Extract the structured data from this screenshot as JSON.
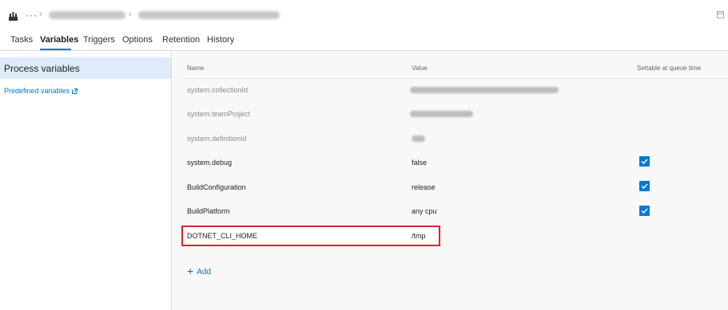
{
  "tabs": [
    {
      "label": "Tasks"
    },
    {
      "label": "Variables"
    },
    {
      "label": "Triggers"
    },
    {
      "label": "Options"
    },
    {
      "label": "Retention"
    },
    {
      "label": "History"
    }
  ],
  "active_tab": "Variables",
  "sidebar": {
    "process_variables_label": "Process variables",
    "predefined_link_label": "Predefined variables"
  },
  "columns": {
    "name": "Name",
    "value": "Value",
    "settable": "Settable at queue time"
  },
  "variables": [
    {
      "name": "system.collectionId",
      "value": "",
      "system": true
    },
    {
      "name": "system.teamProject",
      "value": "",
      "system": true
    },
    {
      "name": "system.definitionId",
      "value": "",
      "system": true
    },
    {
      "name": "system.debug",
      "value": "false",
      "settable": true
    },
    {
      "name": "BuildConfiguration",
      "value": "release",
      "settable": true
    },
    {
      "name": "BuildPlatform",
      "value": "any cpu",
      "settable": true
    },
    {
      "name": "DOTNET_CLI_HOME",
      "value": "/tmp",
      "settable": false,
      "highlighted": true
    }
  ],
  "add_label": "Add",
  "colors": {
    "accent": "#0078d4",
    "highlight_border": "#d9262a",
    "sidebar_selected": "#deecf9"
  },
  "icons": [
    "pipeline-icon",
    "more-icon",
    "chevron-right-icon",
    "save-icon",
    "external-link-icon",
    "checkmark-icon",
    "plus-icon"
  ]
}
